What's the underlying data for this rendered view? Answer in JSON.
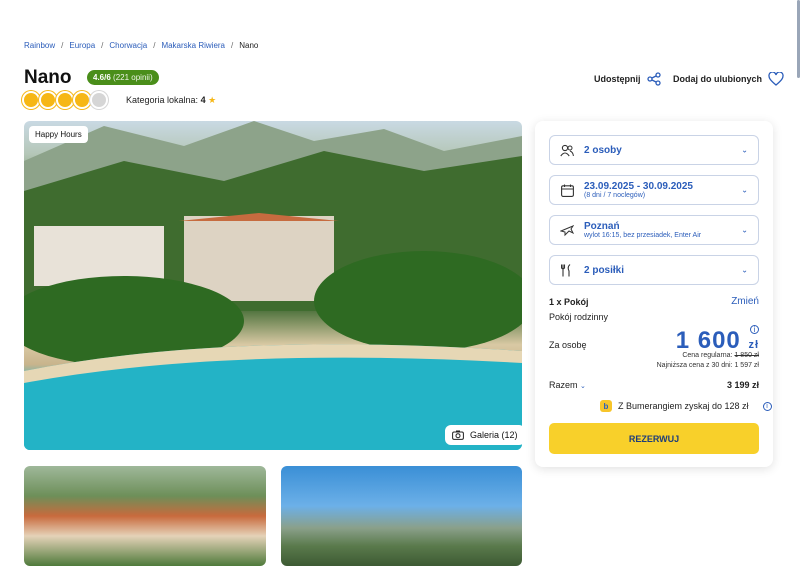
{
  "breadcrumb": [
    "Rainbow",
    "Europa",
    "Chorwacja",
    "Makarska Riwiera",
    "Nano"
  ],
  "hotel": {
    "name": "Nano",
    "rating": "4.6/6",
    "reviews": "(221 opinii)",
    "suns_filled": 4,
    "suns_total": 5,
    "local_category_label": "Kategoria lokalna:",
    "local_category_value": "4"
  },
  "actions": {
    "share": "Udostępnij",
    "favorite": "Dodaj do ulubionych"
  },
  "media": {
    "badge": "Happy Hours",
    "gallery": "Galeria (12)"
  },
  "booking": {
    "persons": "2 osoby",
    "dates": "23.09.2025 - 30.09.2025",
    "dates_sub": "(8 dni / 7 noclegów)",
    "departure": "Poznań",
    "departure_sub": "wylot 16:15, bez przesiadek, Enter Air",
    "meals": "2 posiłki",
    "room_count": "1 x Pokój",
    "change": "Zmień",
    "room_type": "Pokój rodzinny",
    "per_person_label": "Za osobę",
    "price": "1 600",
    "currency": "zł",
    "regular_label": "Cena regularna:",
    "regular_price": "1 850 zł",
    "lowest_label": "Najniższa cena z 30 dni:",
    "lowest_price": "1 597 zł",
    "total_label": "Razem",
    "total_value": "3 199 zł",
    "boomerang": "Z Bumerangiem zyskaj do 128 zł",
    "reserve": "REZERWUJ"
  },
  "colors": {
    "accent": "#2b5dba",
    "rating_bg": "#4a8e1a",
    "cta": "#f8d02a",
    "sun": "#f6b716"
  }
}
